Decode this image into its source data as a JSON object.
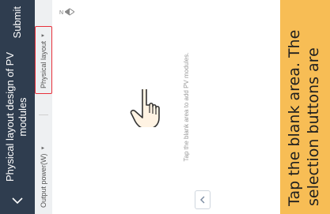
{
  "header": {
    "title": "Physical layout design of PV modules",
    "submit_label": "Submit"
  },
  "tabs": [
    {
      "label": "Output power(W)"
    },
    {
      "label": "Physical layout"
    }
  ],
  "canvas": {
    "compass_letter": "N",
    "hint": "Tap the blank area to add PV modules."
  },
  "instruction": {
    "text": "Tap the blank area. The selection buttons are"
  },
  "colors": {
    "header_bg": "#2f3d4f",
    "highlight_border": "#e8303a",
    "banner_bg": "#f7bd55"
  },
  "icons": {
    "back": "chevron-left-icon",
    "compass": "compass-arrow-icon",
    "collapse": "chevron-up-icon",
    "gesture": "tap-hand-icon"
  }
}
